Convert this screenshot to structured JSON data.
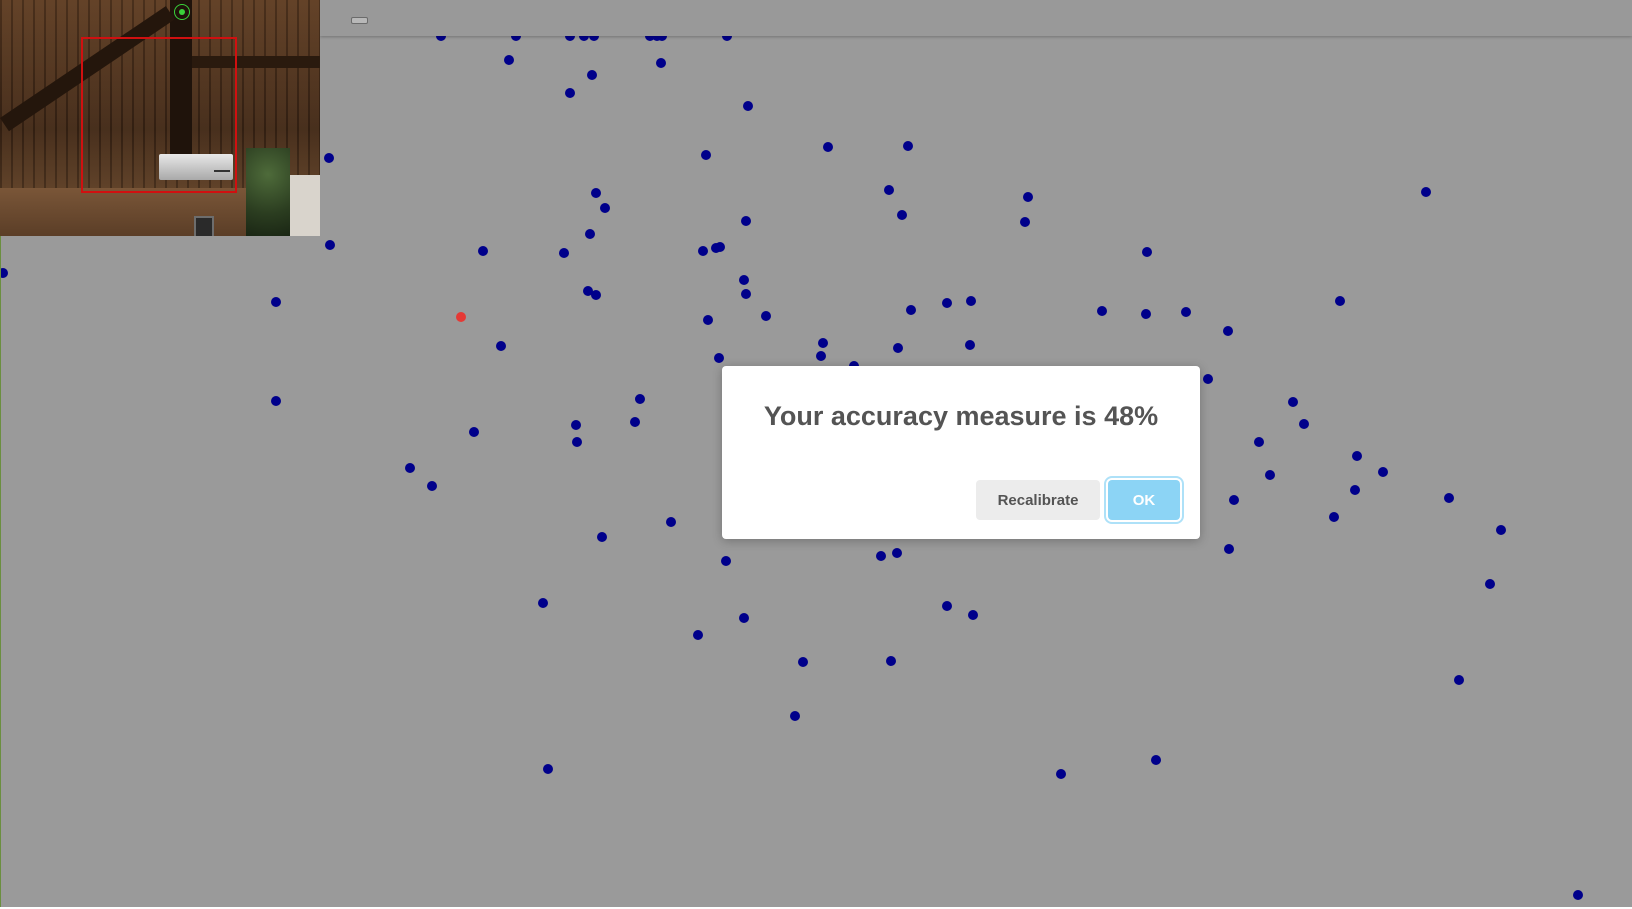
{
  "dialog": {
    "message": "Your accuracy measure is 48%",
    "recalibrate_label": "Recalibrate",
    "ok_label": "OK"
  },
  "colors": {
    "background": "#9a9a9a",
    "dot": "#00008b",
    "target_dot": "#e53935",
    "face_box": "#d01010",
    "ok_button": "#8cd4f5"
  },
  "icons": {
    "webcam_status": "webcam-status-icon",
    "topbar_handle": "collapse-handle-icon"
  }
}
